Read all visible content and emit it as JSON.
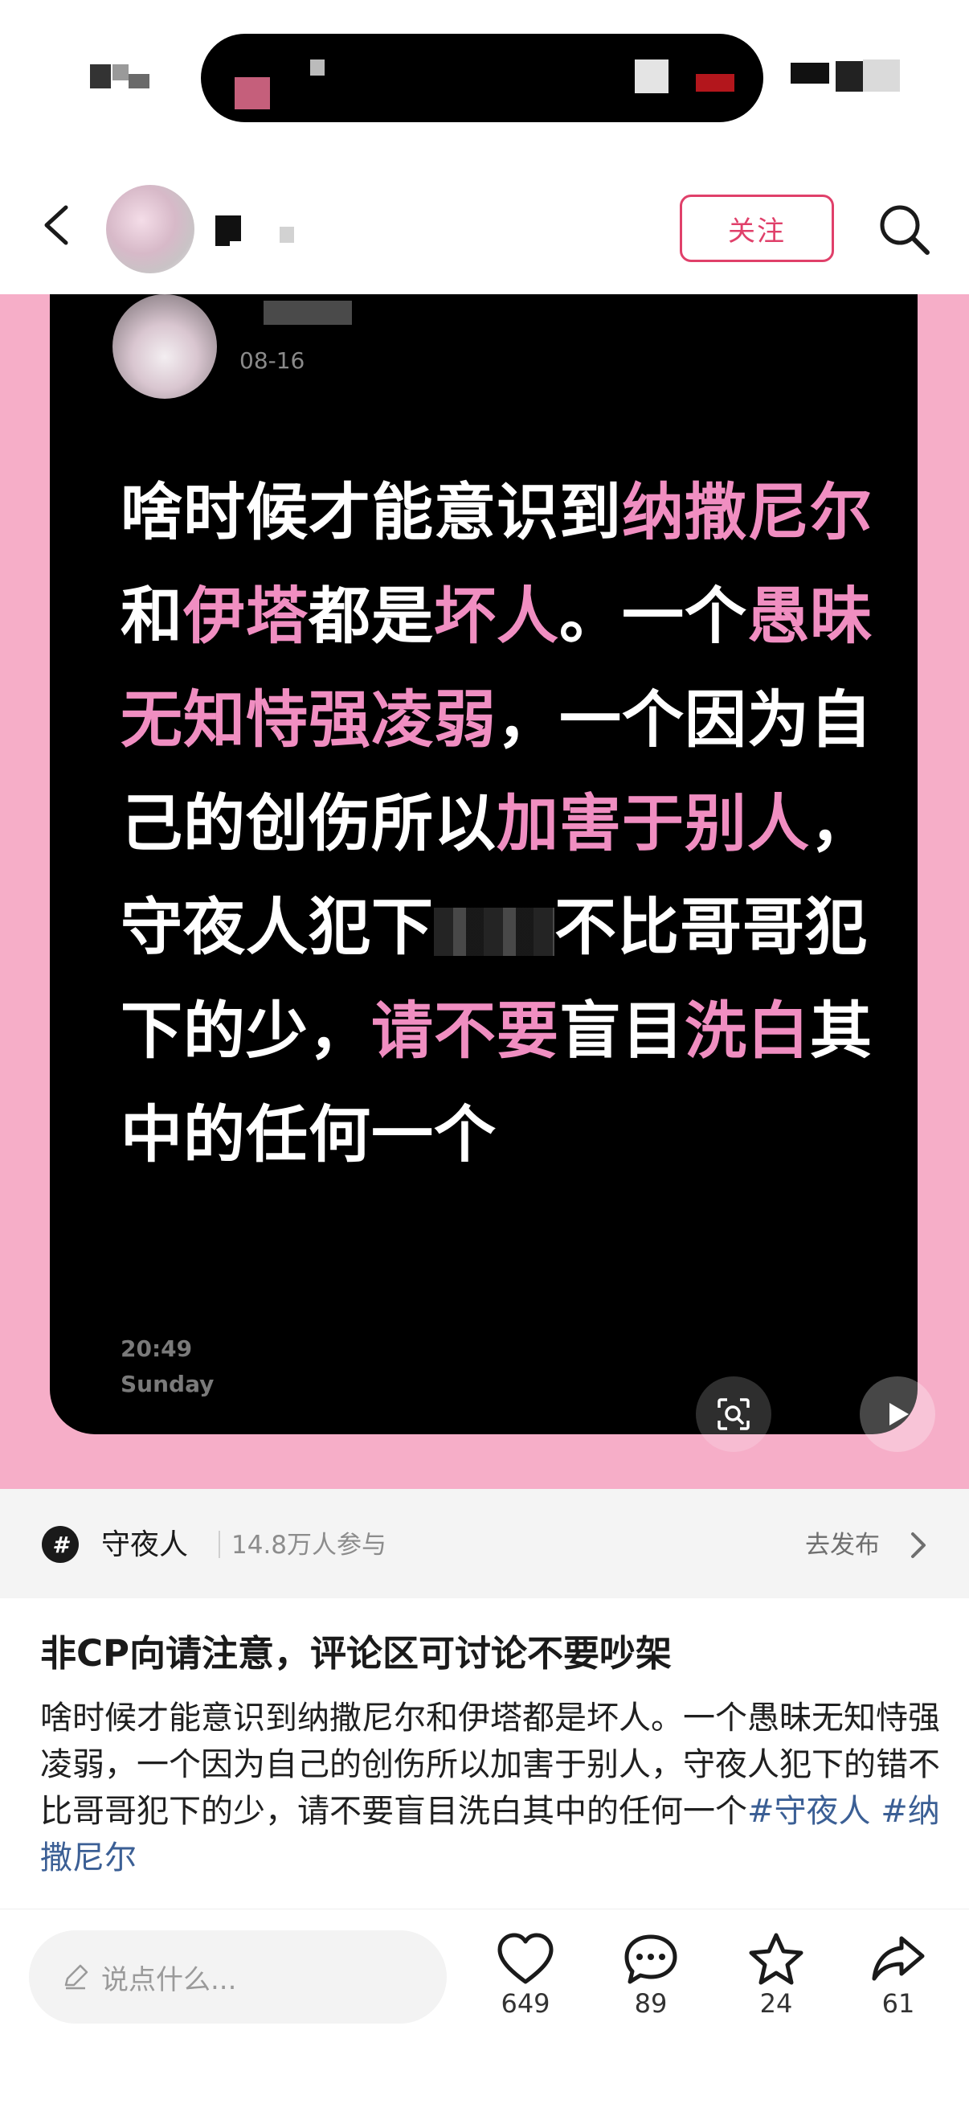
{
  "header": {
    "follow_label": "关注"
  },
  "card": {
    "date": "08-16",
    "text_segments": [
      {
        "t": "啥时候才能意识到",
        "h": false
      },
      {
        "t": "纳撒尼尔",
        "h": true
      },
      {
        "t": "和",
        "h": false
      },
      {
        "t": "伊塔",
        "h": true
      },
      {
        "t": "都是",
        "h": false
      },
      {
        "t": "坏人",
        "h": true
      },
      {
        "t": "。一个",
        "h": false
      },
      {
        "t": "愚昧无知恃强凌弱",
        "h": true
      },
      {
        "t": "，一个因为自己的创伤所以",
        "h": false
      },
      {
        "t": "加害于别人",
        "h": true
      },
      {
        "t": "，守夜人犯下",
        "h": false
      },
      {
        "t": "[censored]",
        "h": false
      },
      {
        "t": "不比哥哥犯下的少，",
        "h": false
      },
      {
        "t": "请不要",
        "h": true
      },
      {
        "t": "盲目",
        "h": false
      },
      {
        "t": "洗白",
        "h": true
      },
      {
        "t": "其中的任何一个",
        "h": false
      }
    ],
    "time": "20:49",
    "day": "Sunday"
  },
  "topic": {
    "icon_glyph": "#",
    "name": "守夜人",
    "participants": "14.8万人参与",
    "publish_label": "去发布"
  },
  "post": {
    "title": "非CP向请注意，评论区可讨论不要吵架",
    "body": "啥时候才能意识到纳撒尼尔和伊塔都是坏人。一个愚昧无知恃强凌弱，一个因为自己的创伤所以加害于别人，守夜人犯下的错不比哥哥犯下的少，请不要盲目洗白其中的任何一个",
    "tags": [
      "#守夜人",
      "#纳撒尼尔"
    ]
  },
  "bottom": {
    "comment_placeholder": "说点什么...",
    "likes": "649",
    "comments": "89",
    "stars": "24",
    "shares": "61"
  },
  "colors": {
    "accent": "#e0406a",
    "highlight": "#f08ec1",
    "media_bg": "#f6aec8",
    "tag": "#3b5f95"
  },
  "icons": [
    "back-arrow-icon",
    "search-icon",
    "scan-icon",
    "play-icon",
    "hashtag-icon",
    "chevron-right-icon",
    "pencil-icon",
    "heart-icon",
    "comment-icon",
    "star-icon",
    "share-icon"
  ]
}
